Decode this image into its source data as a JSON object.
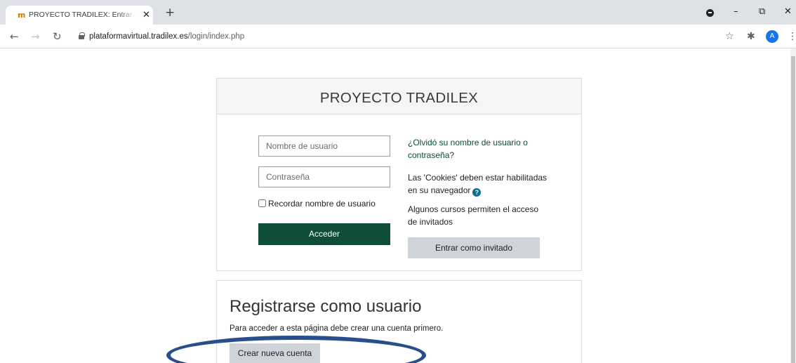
{
  "browser": {
    "tab": {
      "favicon": "m",
      "title": "PROYECTO TRADILEX: Entrar al sitio",
      "close": "✕"
    },
    "new_tab": "+",
    "window_controls": {
      "minimize": "–",
      "restore": "⧉",
      "close": "✕"
    },
    "nav": {
      "back": "←",
      "forward": "→",
      "reload": "↻"
    },
    "url": {
      "host": "plataformavirtual.tradilex.es",
      "path": "/login/index.php"
    },
    "toolbar": {
      "star": "☆",
      "extensions": "✱",
      "profile_initial": "A",
      "menu": "⋮"
    },
    "icons": [
      "moodle-favicon-icon",
      "lock-icon",
      "star-icon",
      "puzzle-icon",
      "profile-icon",
      "kebab-menu-icon"
    ]
  },
  "login": {
    "site_title": "PROYECTO TRADILEX",
    "username_placeholder": "Nombre de usuario",
    "password_placeholder": "Contraseña",
    "remember_label": "Recordar nombre de usuario",
    "login_button": "Acceder",
    "forgot_link": "¿Olvidó su nombre de usuario o contraseña?",
    "cookies_notice": "Las 'Cookies' deben estar habilitadas en su navegador",
    "help_icon": "?",
    "guest_notice": "Algunos cursos permiten el acceso de invitados",
    "guest_button": "Entrar como invitado"
  },
  "signup": {
    "title": "Registrarse como usuario",
    "info": "Para acceder a esta página debe crear una cuenta primero.",
    "create_button": "Crear nueva cuenta"
  },
  "colors": {
    "primary": "#0f4c3a",
    "secondary_button": "#ced4da",
    "help_icon": "#0e6e91",
    "highlight": "#294e8c",
    "tabstrip": "#dee1e6"
  }
}
